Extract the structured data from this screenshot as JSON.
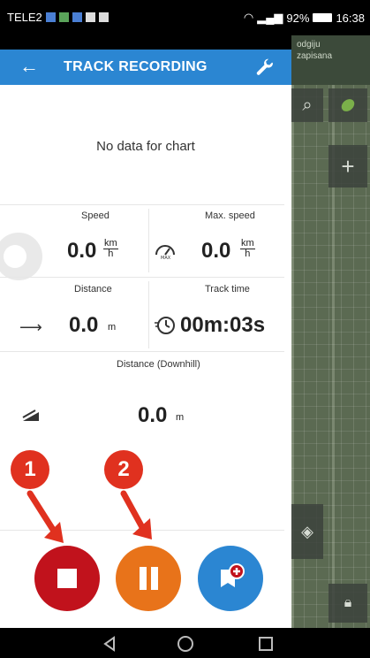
{
  "status_bar": {
    "carrier": "TELE2",
    "signal_battery": "92%",
    "time": "16:38"
  },
  "app_bar": {
    "title": "TRACK RECORDING"
  },
  "chart": {
    "empty_message": "No data for chart"
  },
  "stats": {
    "speed": {
      "label": "Speed",
      "value": "0.0",
      "unit_top": "km",
      "unit_bottom": "h"
    },
    "max_speed": {
      "label": "Max. speed",
      "value": "0.0",
      "unit_top": "km",
      "unit_bottom": "h"
    },
    "distance": {
      "label": "Distance",
      "value": "0.0",
      "unit": "m"
    },
    "track_time": {
      "label": "Track time",
      "value": "00m:03s"
    },
    "distance_downhill": {
      "label": "Distance (Downhill)",
      "value": "0.0",
      "unit": "m"
    }
  },
  "map_overlay": {
    "line1": "odgiju",
    "line2": "zapisana"
  },
  "annotations": {
    "badge_1": "1",
    "badge_2": "2"
  },
  "colors": {
    "accent": "#2b86d2",
    "stop": "#c1121c",
    "pause": "#e8731a",
    "annotation": "#e0311f"
  }
}
